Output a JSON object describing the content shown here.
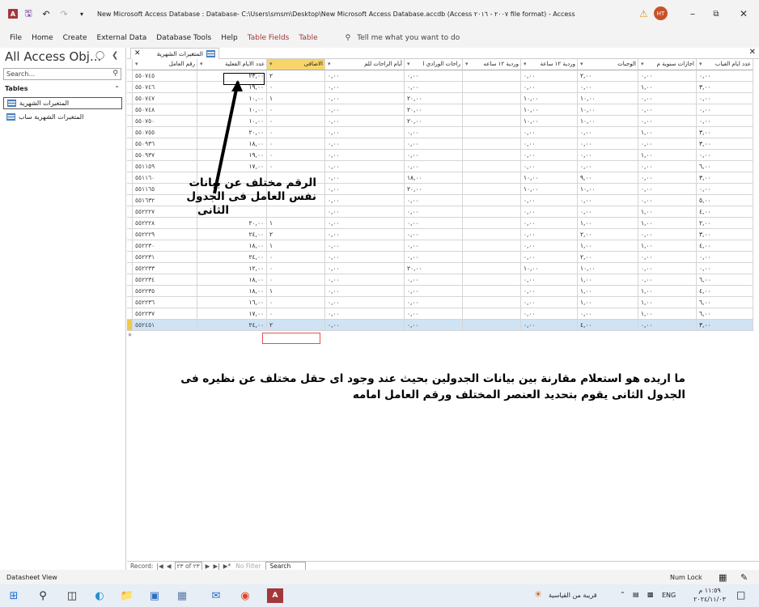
{
  "window": {
    "title": "New Microsoft Access Database : Database- C:\\Users\\smsm\\Desktop\\New Microsoft Access Database.accdb (Access ٢٠٠٧ - ٢٠١٦ file format)  -  Access",
    "avatar": "HT"
  },
  "menu": {
    "items": [
      "File",
      "Home",
      "Create",
      "External Data",
      "Database Tools",
      "Help"
    ],
    "context_items": [
      "Table Fields",
      "Table"
    ],
    "tell_me": "Tell me what you want to do"
  },
  "nav_pane": {
    "title": "All Access Obj...",
    "search_placeholder": "Search...",
    "group": "Tables",
    "items": [
      "المتغيرات الشهرية",
      "المتغيرات الشهرية ساب"
    ]
  },
  "document": {
    "tab_label": "المتغيرات الشهرية",
    "columns": [
      "رقم العامل",
      "عدد الايام الفعلية",
      "الاضافى",
      "أيام الراحات للم",
      "راحات الورادي ا",
      "وردية ١٢ ساعه",
      "وردية ١٢ ساعة",
      "الوجبات",
      "اجازات سنوية م",
      "عدد ايام الغياب"
    ],
    "rows": [
      [
        "٥٥٠٧٤٥",
        "٢٣,٠٠",
        "٢",
        "٠,٠٠",
        "٠,٠٠",
        "",
        "٠,٠٠",
        "٢,٠٠",
        "٠,٠٠",
        "٠,٠٠"
      ],
      [
        "٥٥٠٧٤٦",
        "١٩,٠٠",
        "٠",
        "٠,٠٠",
        "٠,٠٠",
        "",
        "٠,٠٠",
        "٠,٠٠",
        "١,٠٠",
        "٣,٠٠"
      ],
      [
        "٥٥٠٧٤٧",
        "١٠,٠٠",
        "١",
        "٠,٠٠",
        "٢٠,٠٠",
        "",
        "١٠,٠٠",
        "١٠,٠٠",
        "٠,٠٠",
        "٠,٠٠"
      ],
      [
        "٥٥٠٧٤٨",
        "١٠,٠٠",
        "٠",
        "٠,٠٠",
        "٢٠,٠٠",
        "",
        "١٠,٠٠",
        "١٠,٠٠",
        "٠,٠٠",
        "٠,٠٠"
      ],
      [
        "٥٥٠٧٥٠",
        "١٠,٠٠",
        "٠",
        "٠,٠٠",
        "٢٠,٠٠",
        "",
        "١٠,٠٠",
        "١٠,٠٠",
        "٠,٠٠",
        "٠,٠٠"
      ],
      [
        "٥٥٠٧٥٥",
        "٢٠,٠٠",
        "٠",
        "٠,٠٠",
        "٠,٠٠",
        "",
        "٠,٠٠",
        "٠,٠٠",
        "١,٠٠",
        "٣,٠٠"
      ],
      [
        "٥٥٠٩٣٦",
        "١٨,٠٠",
        "٠",
        "٠,٠٠",
        "٠,٠٠",
        "",
        "٠,٠٠",
        "٠,٠٠",
        "٠,٠٠",
        "٣,٠٠"
      ],
      [
        "٥٥٠٩٣٧",
        "١٩,٠٠",
        "٠",
        "٠,٠٠",
        "٠,٠٠",
        "",
        "٠,٠٠",
        "٠,٠٠",
        "١,٠٠",
        "٠,٠٠"
      ],
      [
        "٥٥١١٥٩",
        "١٧,٠٠",
        "٠",
        "٠,٠٠",
        "٠,٠٠",
        "",
        "٠,٠٠",
        "٠,٠٠",
        "٠,٠٠",
        "٦,٠٠"
      ],
      [
        "٥٥١١٦٠",
        "",
        "",
        "٠,٠٠",
        "١٨,٠٠",
        "",
        "١٠,٠٠",
        "٩,٠٠",
        "٠,٠٠",
        "٣,٠٠"
      ],
      [
        "٥٥١١٦٥",
        "",
        "",
        "٠,٠٠",
        "٢٠,٠٠",
        "",
        "١٠,٠٠",
        "١٠,٠٠",
        "٠,٠٠",
        "٠,٠٠"
      ],
      [
        "٥٥١٦٣٢",
        "",
        "",
        "٠,٠٠",
        "٠,٠٠",
        "",
        "٠,٠٠",
        "٠,٠٠",
        "٠,٠٠",
        "٥,٠٠"
      ],
      [
        "٥٥٢٢٢٧",
        "",
        "",
        "٠,٠٠",
        "٠,٠٠",
        "",
        "٠,٠٠",
        "٠,٠٠",
        "١,٠٠",
        "٤,٠٠"
      ],
      [
        "٥٥٢٢٢٨",
        "٢٠,٠٠",
        "١",
        "٠,٠٠",
        "٠,٠٠",
        "",
        "٠,٠٠",
        "١,٠٠",
        "١,٠٠",
        "٢,٠٠"
      ],
      [
        "٥٥٢٢٢٩",
        "٢٤,٠٠",
        "٢",
        "٠,٠٠",
        "٠,٠٠",
        "",
        "٠,٠٠",
        "٢,٠٠",
        "٠,٠٠",
        "٣,٠٠"
      ],
      [
        "٥٥٢٢٣٠",
        "١٨,٠٠",
        "١",
        "٠,٠٠",
        "٠,٠٠",
        "",
        "٠,٠٠",
        "١,٠٠",
        "١,٠٠",
        "٤,٠٠"
      ],
      [
        "٥٥٢٢٣١",
        "٢٤,٠٠",
        "٠",
        "٠,٠٠",
        "٠,٠٠",
        "",
        "٠,٠٠",
        "٢,٠٠",
        "٠,٠٠",
        "٠,٠٠"
      ],
      [
        "٥٥٢٢٣٣",
        "١٢,٠٠",
        "٠",
        "٠,٠٠",
        "٢٠,٠٠",
        "",
        "١٠,٠٠",
        "١٠,٠٠",
        "٠,٠٠",
        "٠,٠٠"
      ],
      [
        "٥٥٢٢٣٤",
        "١٨,٠٠",
        "٠",
        "٠,٠٠",
        "٠,٠٠",
        "",
        "٠,٠٠",
        "١,٠٠",
        "٠,٠٠",
        "٦,٠٠"
      ],
      [
        "٥٥٢٢٣٥",
        "١٨,٠٠",
        "١",
        "٠,٠٠",
        "٠,٠٠",
        "",
        "٠,٠٠",
        "١,٠٠",
        "١,٠٠",
        "٤,٠٠"
      ],
      [
        "٥٥٢٢٣٦",
        "١٦,٠٠",
        "٠",
        "٠,٠٠",
        "٠,٠٠",
        "",
        "٠,٠٠",
        "١,٠٠",
        "١,٠٠",
        "٦,٠٠"
      ],
      [
        "٥٥٢٢٣٧",
        "١٧,٠٠",
        "٠",
        "٠,٠٠",
        "٠,٠٠",
        "",
        "٠,٠٠",
        "٠,٠٠",
        "١,٠٠",
        "٦,٠٠"
      ],
      [
        "٥٥٢٤٥١",
        "٢٤,٠٠",
        "٢",
        "٠,٠٠",
        "٠,٠٠",
        "",
        "٠,٠٠",
        "٤,٠٠",
        "٠,٠٠",
        "٣,٠٠"
      ]
    ],
    "new_row_marker": "*"
  },
  "annotations": {
    "callout_lines": [
      "الرقم مختلف عن بيانات",
      "نفس العامل فى الجدول",
      "الثانى"
    ],
    "question_lines": [
      "ما اريده هو استعلام مقارنة بين بيانات الجدولين بحيث عند وجود اى حقل مختلف عن نظيره فى",
      "الجدول الثانى يقوم بتحديد العنصر المختلف ورقم العامل امامه"
    ]
  },
  "record_nav": {
    "label": "Record:",
    "position": "٢٣ of ٢٣",
    "filter": "No Filter",
    "search": "Search"
  },
  "status": {
    "view": "Datasheet View",
    "numlock": "Num Lock"
  },
  "taskbar": {
    "weather": "قريبة من القياسية",
    "lang": "ENG",
    "time": "١١:٥٩ م",
    "date": "٢٠٢٤/١١/٠٣"
  },
  "colors": {
    "accent": "#a4373a",
    "header_selected": "#f7d56a",
    "row_selected": "#cfe3f5"
  }
}
